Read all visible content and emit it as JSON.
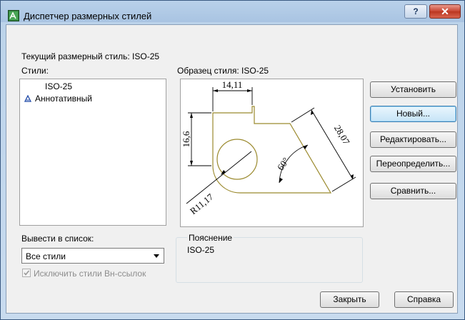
{
  "window": {
    "title": "Диспетчер размерных стилей",
    "help_label": "?",
    "close_label": "✕"
  },
  "current_style_label": "Текущий размерный стиль: ISO-25",
  "styles": {
    "label": "Стили:",
    "items": [
      {
        "name": "ISO-25",
        "icon": "none"
      },
      {
        "name": "Аннотативный",
        "icon": "annotative-icon"
      }
    ]
  },
  "preview": {
    "label": "Образец стиля: ISO-25",
    "dims": {
      "top": "14,11",
      "left": "16,6",
      "slant": "28,07",
      "angle": "60°",
      "radius": "R11,17"
    }
  },
  "buttons": {
    "set": "Установить",
    "new": "Новый...",
    "edit": "Редактировать...",
    "override": "Переопределить...",
    "compare": "Сравнить...",
    "close": "Закрыть",
    "help": "Справка"
  },
  "list_filter": {
    "label": "Вывести в список:",
    "value": "Все стили"
  },
  "exclude_xref": {
    "label": "Исключить стили Вн-ссылок",
    "checked": true
  },
  "description": {
    "title": "Пояснение",
    "value": "ISO-25"
  }
}
